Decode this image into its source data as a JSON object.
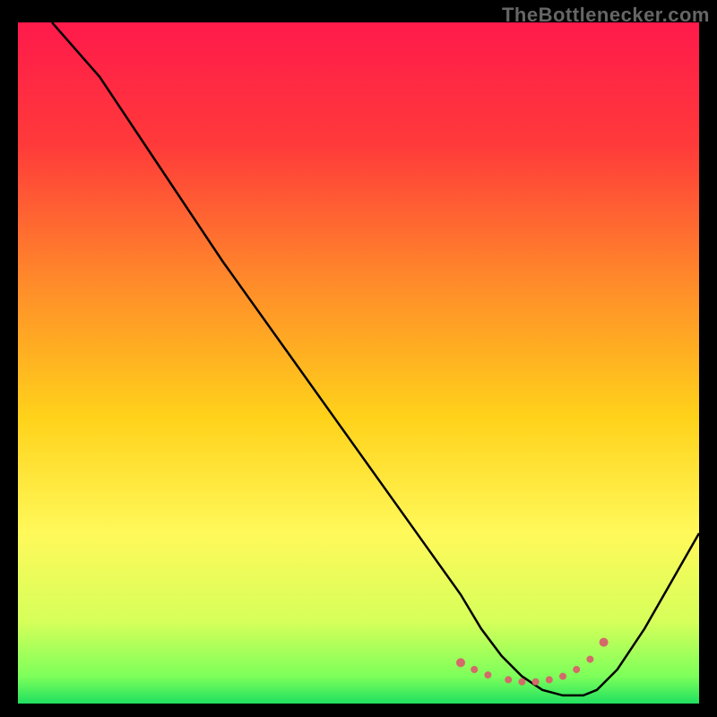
{
  "watermark": "TheBottlenecker.com",
  "chart_data": {
    "type": "line",
    "title": "",
    "xlabel": "",
    "ylabel": "",
    "xlim": [
      0,
      100
    ],
    "ylim": [
      0,
      100
    ],
    "series": [
      {
        "name": "curve",
        "x": [
          5,
          12,
          20,
          30,
          40,
          50,
          60,
          65,
          68,
          71,
          74,
          77,
          80,
          83,
          85,
          88,
          92,
          96,
          100
        ],
        "y": [
          100,
          92,
          80,
          65,
          51,
          37,
          23,
          16,
          11,
          7,
          4,
          2,
          1.2,
          1.2,
          2,
          5,
          11,
          18,
          25
        ]
      },
      {
        "name": "highlight-points",
        "color": "#d46a6a",
        "x": [
          65,
          67,
          69,
          72,
          74,
          76,
          78,
          80,
          82,
          84,
          86
        ],
        "y": [
          6,
          5,
          4.2,
          3.5,
          3.2,
          3.2,
          3.5,
          4,
          5,
          6.5,
          9
        ]
      }
    ],
    "background_gradient": [
      {
        "stop": 0.0,
        "color": "#ff1a4b"
      },
      {
        "stop": 0.18,
        "color": "#ff3a3a"
      },
      {
        "stop": 0.38,
        "color": "#ff8a2a"
      },
      {
        "stop": 0.58,
        "color": "#ffd21a"
      },
      {
        "stop": 0.75,
        "color": "#fff95a"
      },
      {
        "stop": 0.88,
        "color": "#d6ff5a"
      },
      {
        "stop": 0.96,
        "color": "#7dff5a"
      },
      {
        "stop": 1.0,
        "color": "#20e060"
      }
    ]
  }
}
